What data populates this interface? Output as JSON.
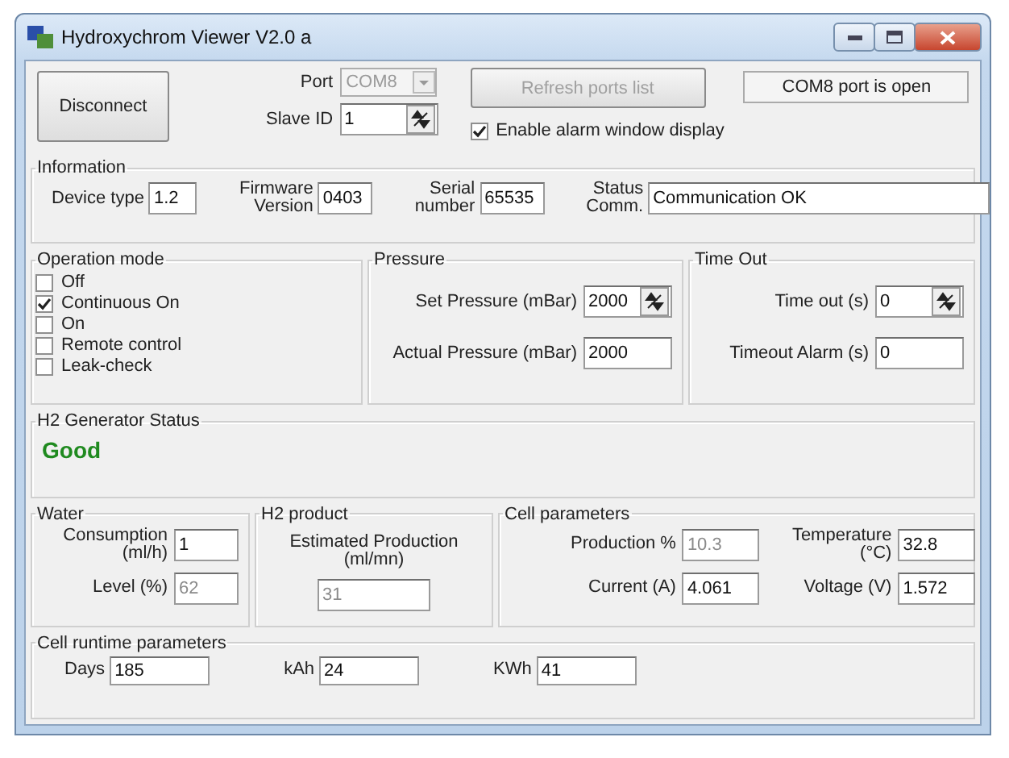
{
  "window": {
    "title": "Hydroxychrom Viewer V2.0 a"
  },
  "connection": {
    "disconnect_button": "Disconnect",
    "port": {
      "label": "Port",
      "value": "COM8",
      "disabled": true
    },
    "slave_id": {
      "label": "Slave ID",
      "value": "1"
    },
    "refresh_button": {
      "label": "Refresh ports list",
      "disabled": true
    },
    "port_status": "COM8 port is open",
    "alarm_checkbox": {
      "label": "Enable alarm window display",
      "checked": true
    }
  },
  "information": {
    "title": "Information",
    "fields": [
      {
        "label": "Device type",
        "value": "1.2",
        "kind": "short"
      },
      {
        "label": "Firmware\nVersion",
        "value": "0403",
        "kind": "short"
      },
      {
        "label": "Serial\nnumber",
        "value": "65535",
        "kind": "short"
      },
      {
        "label": "Status\nComm.",
        "value": "Communication OK",
        "kind": "wide"
      }
    ]
  },
  "operation_mode": {
    "title": "Operation mode",
    "options": [
      {
        "label": "Off",
        "checked": false
      },
      {
        "label": "Continuous On",
        "checked": true
      },
      {
        "label": "On",
        "checked": false
      },
      {
        "label": "Remote control",
        "checked": false
      },
      {
        "label": "Leak-check",
        "checked": false
      }
    ]
  },
  "pressure": {
    "title": "Pressure",
    "fields": [
      {
        "label": "Set Pressure (mBar)",
        "value": "2000",
        "kind": "spin"
      },
      {
        "label": "Actual Pressure (mBar)",
        "value": "2000",
        "kind": "text"
      }
    ]
  },
  "time_out": {
    "title": "Time Out",
    "fields": [
      {
        "label": "Time out (s)",
        "value": "0",
        "kind": "spin"
      },
      {
        "label": "Timeout Alarm (s)",
        "value": "0",
        "kind": "text"
      }
    ]
  },
  "generator_status": {
    "title": "H2 Generator Status",
    "status": "Good"
  },
  "water": {
    "title": "Water",
    "fields": [
      {
        "label": "Consumption\n(ml/h)",
        "value": "1",
        "disabled": false
      },
      {
        "label": "Level (%)",
        "value": "62",
        "disabled": true
      }
    ]
  },
  "h2_product": {
    "title": "H2 product",
    "label": "Estimated Production\n(ml/mn)",
    "value": "31",
    "disabled": true
  },
  "cell_parameters": {
    "title": "Cell parameters",
    "fields": [
      {
        "label": "Production %",
        "value": "10.3",
        "disabled": true
      },
      {
        "label": "Temperature\n(°C)",
        "value": "32.8",
        "disabled": false
      },
      {
        "label": "Current (A)",
        "value": "4.061",
        "disabled": false
      },
      {
        "label": "Voltage (V)",
        "value": "1.572",
        "disabled": false
      }
    ]
  },
  "cell_runtime": {
    "title": "Cell runtime parameters",
    "fields": [
      {
        "label": "Days",
        "value": "185"
      },
      {
        "label": "kAh",
        "value": "24"
      },
      {
        "label": "KWh",
        "value": "41"
      }
    ]
  }
}
